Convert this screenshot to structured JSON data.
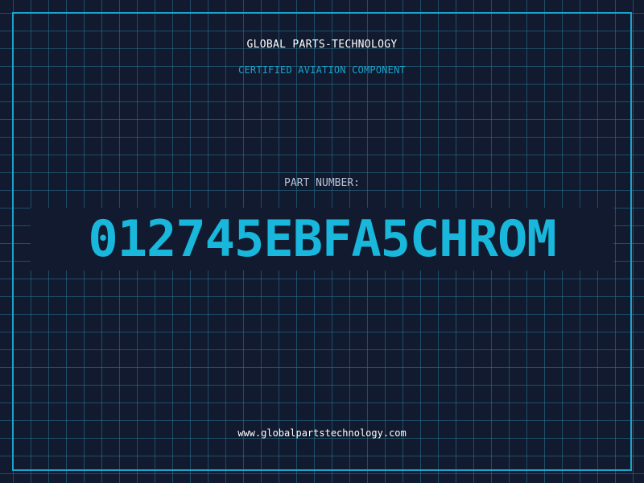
{
  "header": {
    "company_name": "GLOBAL PARTS-TECHNOLOGY",
    "tagline": "CERTIFIED AVIATION COMPONENT"
  },
  "part": {
    "label": "PART NUMBER:",
    "number": "012745EBFA5CHROM"
  },
  "footer": {
    "website": "www.globalpartstechnology.com"
  },
  "colors": {
    "background": "#111a2e",
    "grid": "#287896",
    "accent": "#1aa3cc",
    "part_number": "#19b7dc",
    "text": "#ffffff",
    "label": "#b7c2d6"
  }
}
